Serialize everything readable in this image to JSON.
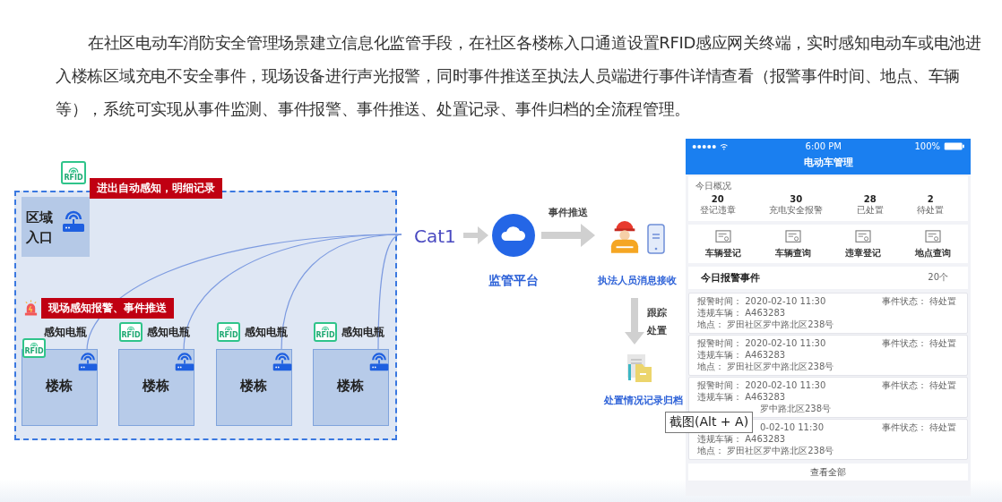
{
  "paragraph": "在社区电动车消防安全管理场景建立信息化监管手段，在社区各楼栋入口通道设置RFID感应网关终端，实时感知电动车或电池进入楼栋区域充电不安全事件，现场设备进行声光报警，同时事件推送至执法人员端进行事件详情查看（报警事件时间、地点、车辆等），系统可实现从事件监测、事件报警、事件推送、处置记录、事件归档的全流程管理。",
  "diagram": {
    "top_tag": "RFID",
    "zone_label": "进出自动感知，明细记录",
    "entrance_label": "区域入口",
    "alarm_label": "现场感知报警、事件推送",
    "buildings": [
      {
        "tag": "RFID",
        "sensor_label": "感知电瓶",
        "name": "楼栋"
      },
      {
        "tag": "RFID",
        "sensor_label": "感知电瓶",
        "name": "楼栋"
      },
      {
        "tag": "RFID",
        "sensor_label": "感知电瓶",
        "name": "楼栋"
      },
      {
        "tag": "RFID",
        "sensor_label": "感知电瓶",
        "name": "楼栋"
      }
    ],
    "link_label": "Cat1",
    "platform_label": "监管平台",
    "push_label": "事件推送",
    "officer_label": "执法人员消息接收",
    "follow_labels": [
      "跟踪",
      "处置"
    ],
    "archive_label": "处置情况记录归档"
  },
  "phone": {
    "time": "6:00 PM",
    "battery": "100%",
    "title": "电动车管理",
    "overview_title": "今日概况",
    "stats": [
      {
        "value": "20",
        "label": "登记违章"
      },
      {
        "value": "30",
        "label": "充电安全报警"
      },
      {
        "value": "28",
        "label": "已处置"
      },
      {
        "value": "2",
        "label": "待处置"
      }
    ],
    "shortcuts": [
      {
        "label": "车辆登记"
      },
      {
        "label": "车辆查询"
      },
      {
        "label": "违章登记"
      },
      {
        "label": "地点查询"
      }
    ],
    "events_title": "今日报警事件",
    "events_count": "20个",
    "events": [
      {
        "status": "事件状态： 待处置",
        "lines": [
          {
            "kind": "full",
            "text": "报警时间： 2020-02-10 11:30"
          },
          {
            "kind": "full",
            "text": "违规车辆： A463283"
          },
          {
            "kind": "full",
            "text": "地点： 罗田社区罗中路北区238号"
          }
        ]
      },
      {
        "status": "事件状态： 待处置",
        "lines": [
          {
            "kind": "full",
            "text": "报警时间： 2020-02-10 11:30"
          },
          {
            "kind": "full",
            "text": "违规车辆： A463283"
          },
          {
            "kind": "full",
            "text": "地点： 罗田社区罗中路北区238号"
          }
        ]
      },
      {
        "status": "事件状态： 待处置",
        "lines": [
          {
            "kind": "full",
            "text": "报警时间： 2020-02-10 11:30"
          },
          {
            "kind": "full",
            "text": "违规车辆： A463283"
          },
          {
            "kind": "partial",
            "text": "罗中路北区238号"
          }
        ]
      },
      {
        "status": "事件状态： 待处置",
        "lines": [
          {
            "kind": "partial",
            "text": "0-02-10 11:30"
          },
          {
            "kind": "full",
            "text": "违规车辆： A463283"
          },
          {
            "kind": "full",
            "text": "地点： 罗田社区罗中路北区238号"
          }
        ]
      }
    ],
    "view_all": "查看全部"
  },
  "tooltip": "截图(Alt + A)"
}
